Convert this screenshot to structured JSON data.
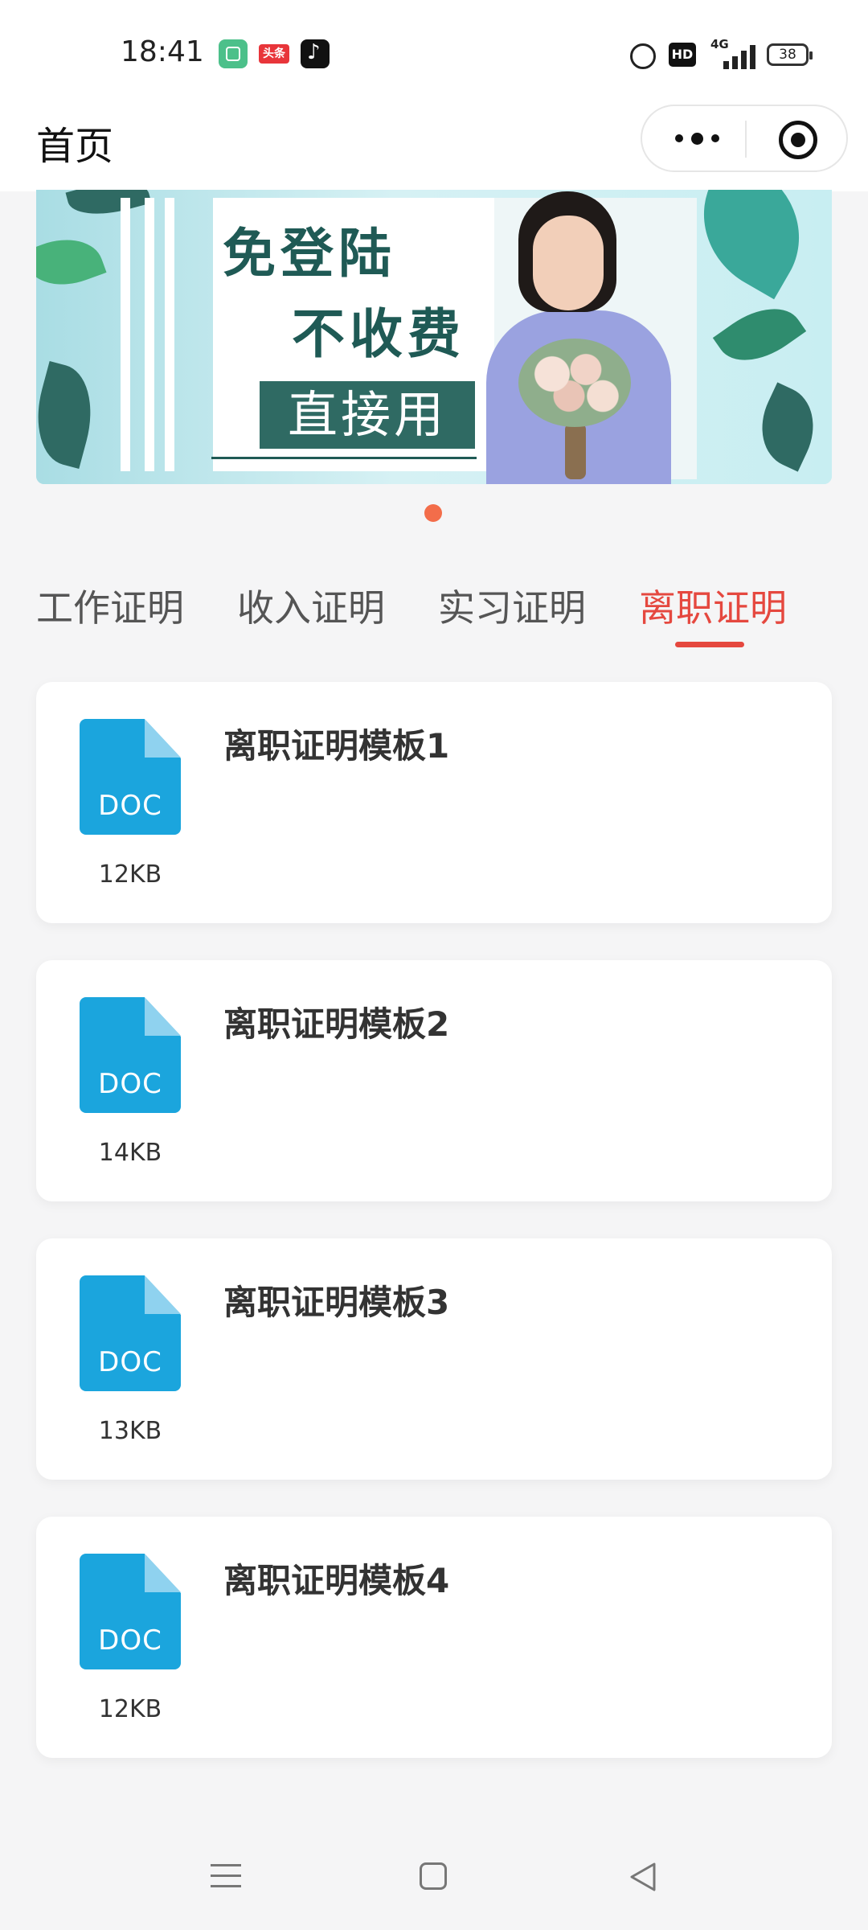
{
  "status_bar": {
    "time": "18:41",
    "app_icons": [
      "gallery-app-icon",
      "toutiao-app-icon",
      "tiktok-app-icon"
    ],
    "toutiao_text": "头条",
    "hd": "HD",
    "network": "4G",
    "battery": "38"
  },
  "nav": {
    "title": "首页",
    "more_icon": "more-dots-icon",
    "close_icon": "target-close-icon"
  },
  "banner": {
    "line1": "免登陆",
    "line2": "不收费",
    "cta": "直接用",
    "active_index": 0,
    "total": 1
  },
  "tabs": [
    {
      "label": "工作证明",
      "active": false
    },
    {
      "label": "收入证明",
      "active": false
    },
    {
      "label": "实习证明",
      "active": false
    },
    {
      "label": "离职证明",
      "active": true
    }
  ],
  "files": [
    {
      "title": "离职证明模板1",
      "size": "12KB",
      "type": "DOC"
    },
    {
      "title": "离职证明模板2",
      "size": "14KB",
      "type": "DOC"
    },
    {
      "title": "离职证明模板3",
      "size": "13KB",
      "type": "DOC"
    },
    {
      "title": "离职证明模板4",
      "size": "12KB",
      "type": "DOC"
    }
  ],
  "colors": {
    "accent": "#e5483f",
    "doc_icon": "#1ba5dd",
    "pager_dot": "#f36d4a"
  },
  "system_nav": [
    "menu-icon",
    "home-icon",
    "back-icon"
  ]
}
